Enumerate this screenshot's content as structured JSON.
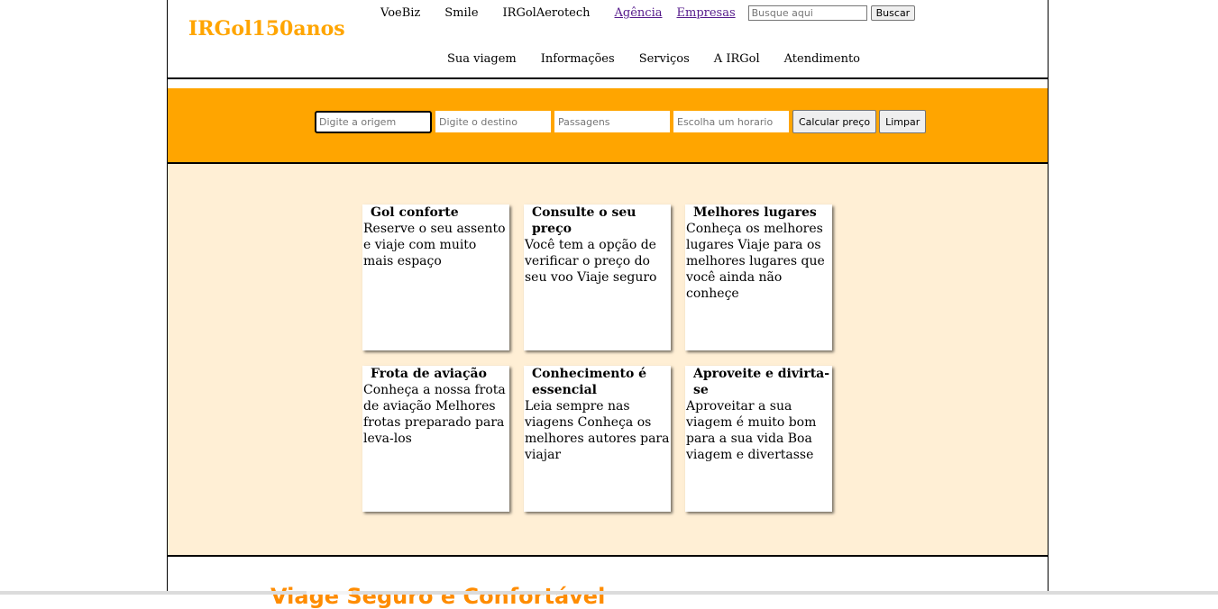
{
  "header": {
    "logo": "IRGol150anos",
    "top_links": [
      "VoeBiz",
      "Smile",
      "IRGolAerotech"
    ],
    "visited_links": [
      "Agência",
      "Empresas"
    ],
    "search_placeholder": "Busque aqui",
    "search_button": "Buscar",
    "main_nav": [
      "Sua viagem",
      "Informações",
      "Serviços",
      "A IRGol",
      "Atendimento"
    ]
  },
  "booking": {
    "origin_placeholder": "Digite a origem",
    "destination_placeholder": "Digite o destino",
    "passengers_placeholder": "Passagens",
    "time_placeholder": "Escolha um horario",
    "calculate_button": "Calcular preço",
    "clear_button": "Limpar"
  },
  "cards": [
    {
      "title": "Gol conforte",
      "text": "Reserve o seu assento e viaje com muito mais espaço"
    },
    {
      "title": "Consulte o seu preço",
      "text": "Você tem a opção de verificar o preço do seu voo Viaje seguro"
    },
    {
      "title": "Melhores lugares",
      "text": "Conheça os melhores lugares Viaje para os melhores lugares que você ainda não conheçe"
    },
    {
      "title": "Frota de aviação",
      "text": "Conheça a nossa frota de aviação Melhores frotas preparado para leva-los"
    },
    {
      "title": "Conhecimento é essencial",
      "text": "Leia sempre nas viagens Conheça os melhores autores para viajar"
    },
    {
      "title": "Aproveite e divirta-se",
      "text": "Aproveitar a sua viagem é muito bom para a sua vida Boa viagem e divertasse"
    }
  ],
  "footer": {
    "title": "Viage Seguro e Confortável"
  },
  "colors": {
    "brand_orange": "#FFA500",
    "content_bg": "#FFEFD5"
  }
}
